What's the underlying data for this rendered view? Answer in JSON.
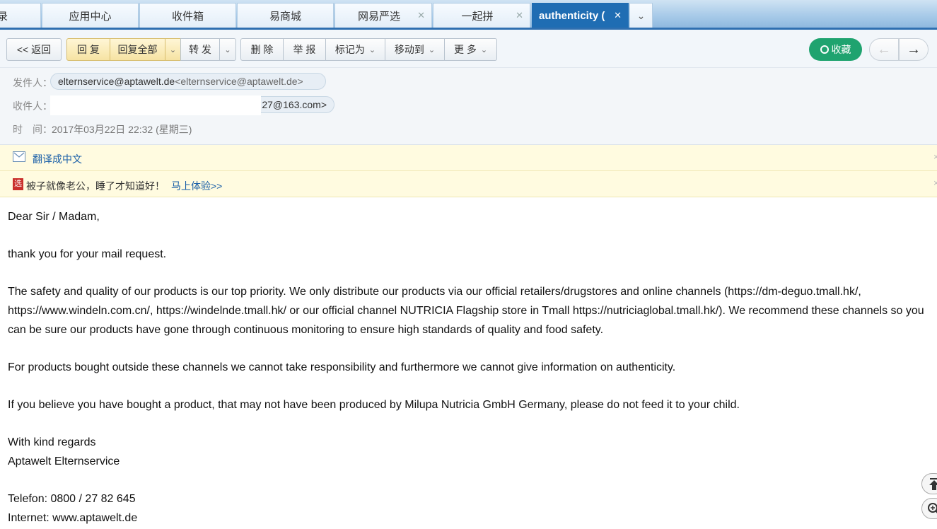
{
  "tabs": [
    {
      "label": "录",
      "closable": false
    },
    {
      "label": "应用中心",
      "closable": false
    },
    {
      "label": "收件箱",
      "closable": false
    },
    {
      "label": "易商城",
      "closable": false
    },
    {
      "label": "网易严选",
      "closable": true
    },
    {
      "label": "一起拼",
      "closable": true
    },
    {
      "label": "authenticity (",
      "closable": true,
      "active": true
    }
  ],
  "tab_close_glyph": "✕",
  "tab_more_glyph": "⌄",
  "toolbar": {
    "back": "<< 返回",
    "reply": "回 复",
    "reply_all": "回复全部",
    "forward": "转 发",
    "delete": "删 除",
    "report": "举 报",
    "mark_as": "标记为",
    "move_to": "移动到",
    "more": "更 多",
    "collect": "收藏",
    "caret": "⌄",
    "prev_arrow": "←",
    "next_arrow": "→"
  },
  "header": {
    "from_label": "发件人：",
    "from_name": "elternservice@aptawelt.de",
    "from_addr": "<elternservice@aptawelt.de>",
    "to_label": "收件人：",
    "to_visible": "27@163.com>",
    "time_label": "时　间：",
    "time_value": "2017年03月22日 22:32 (星期三)"
  },
  "translate_bar": {
    "icon": "envelope-icon",
    "text": "翻译成中文"
  },
  "ad_bar": {
    "icon_text": "选",
    "text": "被子就像老公，睡了才知道好！",
    "link": "马上体验>>"
  },
  "mail": {
    "greeting": "Dear Sir / Madam,",
    "p1": "thank you for your mail request.",
    "p2": "The safety and quality of our products is our top priority. We only distribute our products via our official retailers/drugstores and online channels (https://dm-deguo.tmall.hk/, https://www.windeln.com.cn/, https://windelnde.tmall.hk/ or our official channel NUTRICIA Flagship store in Tmall https://nutriciaglobal.tmall.hk/). We recommend these channels so you can be sure our products have gone through continuous monitoring to ensure high standards of quality and food safety.",
    "p3": "For products bought outside these channels we cannot take responsibility and furthermore we cannot give information on authenticity.",
    "p4": "If you believe you have bought a product, that may not have been produced by Milupa Nutricia GmbH Germany, please do not feed it to your child.",
    "closing": "With kind regards",
    "signature": "Aptawelt Elternservice",
    "phone": "Telefon: 0800 / 27 82 645",
    "internet": "Internet: www.aptawelt.de"
  },
  "colors": {
    "tab_active": "#1f6db3",
    "collect_button": "#1fa36f",
    "link": "#1a5fa8"
  }
}
